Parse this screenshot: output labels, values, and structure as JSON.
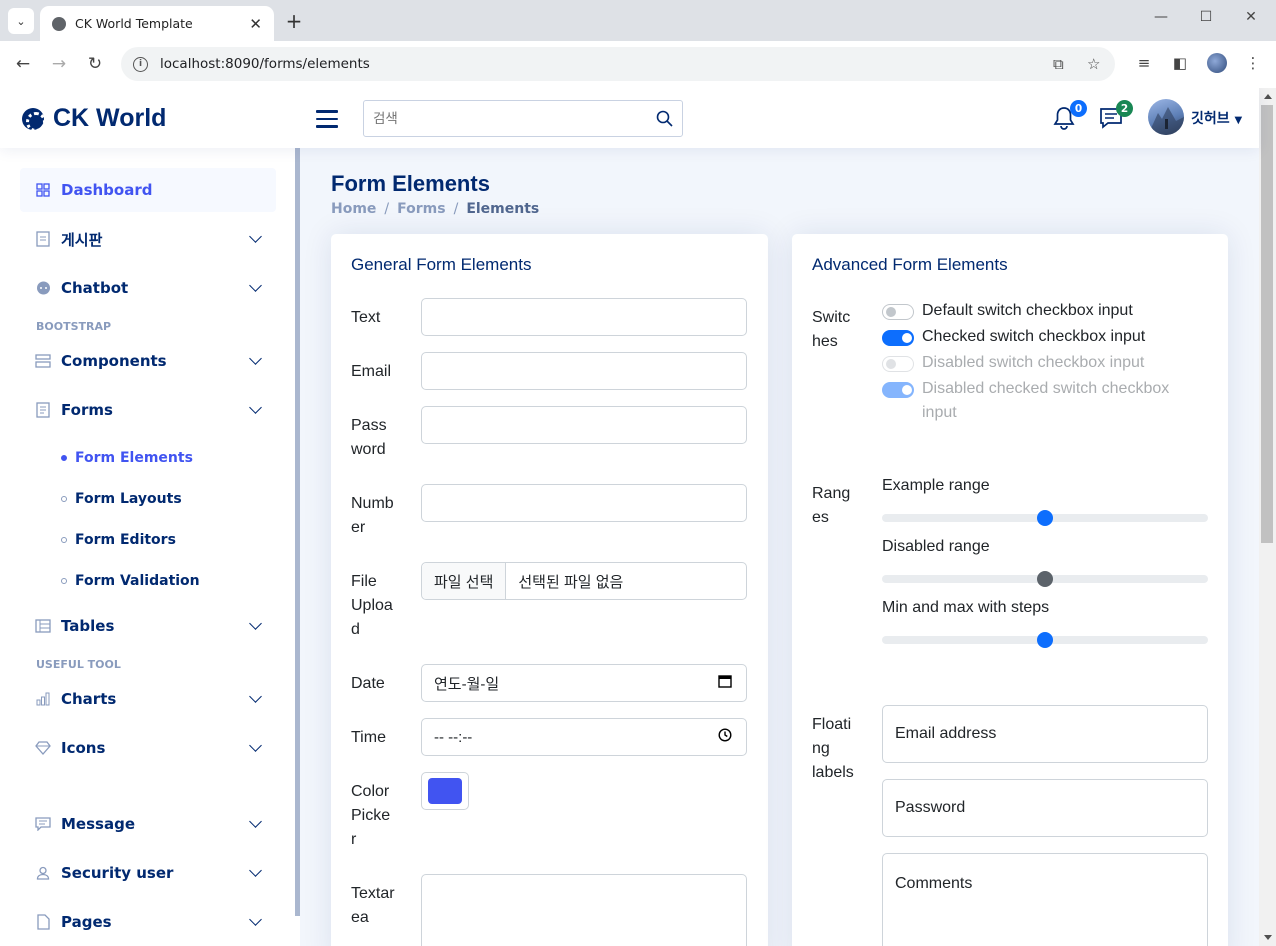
{
  "browser": {
    "tab_title": "CK World Template",
    "url": "localhost:8090/forms/elements"
  },
  "header": {
    "logo_text": "CK World",
    "search_placeholder": "검색",
    "notifications_count": "0",
    "messages_count": "2",
    "user_name": "깃허브"
  },
  "sidebar": {
    "items": [
      {
        "label": "Dashboard",
        "icon": "grid-icon"
      },
      {
        "label": "게시판",
        "icon": "board-icon"
      },
      {
        "label": "Chatbot",
        "icon": "chat-icon"
      },
      {
        "label": "Components",
        "icon": "menu-button-icon"
      },
      {
        "label": "Forms",
        "icon": "journal-icon"
      },
      {
        "label": "Tables",
        "icon": "layout-icon"
      },
      {
        "label": "Charts",
        "icon": "bar-chart-icon"
      },
      {
        "label": "Icons",
        "icon": "gem-icon"
      },
      {
        "label": "Message",
        "icon": "message-icon"
      },
      {
        "label": "Security user",
        "icon": "person-icon"
      },
      {
        "label": "Pages",
        "icon": "file-icon"
      }
    ],
    "headings": [
      "BOOTSTRAP",
      "USEFUL TOOL"
    ],
    "forms_sub": [
      "Form Elements",
      "Form Layouts",
      "Form Editors",
      "Form Validation"
    ]
  },
  "main": {
    "page_title": "Form Elements",
    "breadcrumb": [
      "Home",
      "Forms",
      "Elements"
    ],
    "general": {
      "title": "General Form Elements",
      "labels": {
        "text": "Text",
        "email": "Email",
        "password": "Pass\nword",
        "number": "Numb\ner",
        "file": "File\nUploa\nd",
        "date": "Date",
        "time": "Time",
        "color": "Color\nPicke\nr",
        "textarea": "Textar\nea"
      },
      "file_button": "파일 선택",
      "file_status": "선택된 파일 없음",
      "date_value": "연도-월-일",
      "time_value": "-- --:--",
      "color_value": "#4154f1"
    },
    "advanced": {
      "title": "Advanced Form Elements",
      "switches_label": "Switc\nhes",
      "switches": [
        {
          "label": "Default switch checkbox input",
          "checked": false,
          "disabled": false
        },
        {
          "label": "Checked switch checkbox input",
          "checked": true,
          "disabled": false
        },
        {
          "label": "Disabled switch checkbox input",
          "checked": false,
          "disabled": true
        },
        {
          "label": "Disabled checked switch checkbox input",
          "checked": true,
          "disabled": true
        }
      ],
      "ranges_label": "Rang\nes",
      "ranges": [
        {
          "label": "Example range",
          "value": 0.5
        },
        {
          "label": "Disabled range",
          "value": 0.5
        },
        {
          "label": "Min and max with steps",
          "value": 0.5
        }
      ],
      "floating_label": "Floati\nng\nlabels",
      "floating": {
        "email": "Email address",
        "password": "Password",
        "comments": "Comments"
      }
    }
  }
}
